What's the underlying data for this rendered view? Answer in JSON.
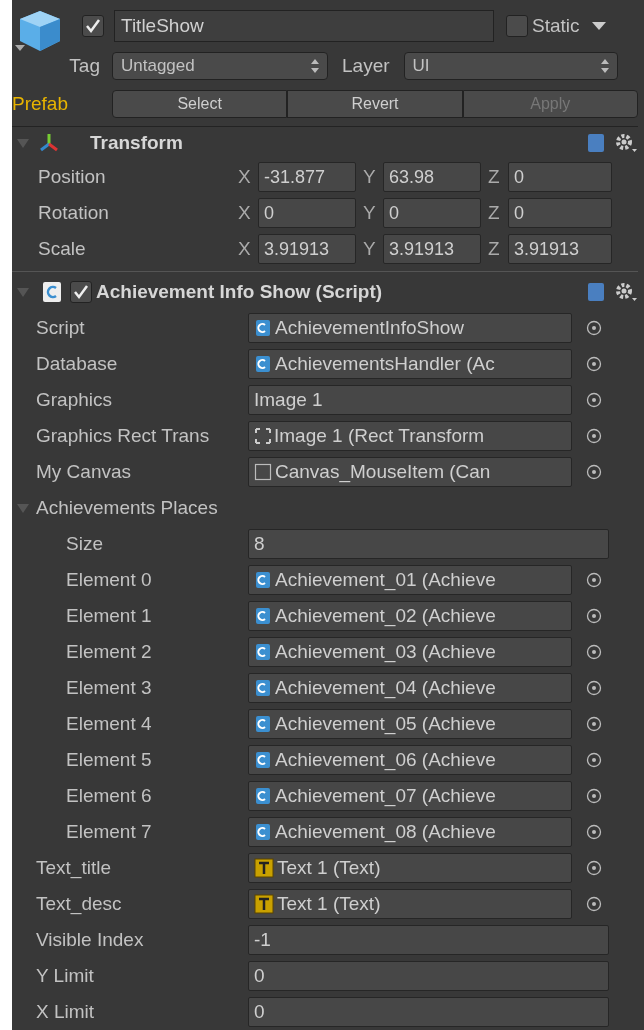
{
  "object": {
    "active": true,
    "name": "TitleShow",
    "static": false,
    "static_label": "Static",
    "tag_label": "Tag",
    "tag": "Untagged",
    "layer_label": "Layer",
    "layer": "UI",
    "prefab_label": "Prefab",
    "prefab_buttons": [
      {
        "label": "Select",
        "disabled": false
      },
      {
        "label": "Revert",
        "disabled": false
      },
      {
        "label": "Apply",
        "disabled": true
      }
    ]
  },
  "transform": {
    "title": "Transform",
    "expanded": true,
    "rows": [
      {
        "label": "Position",
        "fields": [
          {
            "axis": "X",
            "value": "-31.877"
          },
          {
            "axis": "Y",
            "value": "63.98"
          },
          {
            "axis": "Z",
            "value": "0"
          }
        ]
      },
      {
        "label": "Rotation",
        "fields": [
          {
            "axis": "X",
            "value": "0"
          },
          {
            "axis": "Y",
            "value": "0"
          },
          {
            "axis": "Z",
            "value": "0"
          }
        ]
      },
      {
        "label": "Scale",
        "fields": [
          {
            "axis": "X",
            "value": "3.91913"
          },
          {
            "axis": "Y",
            "value": "3.91913"
          },
          {
            "axis": "Z",
            "value": "3.91913"
          }
        ]
      }
    ]
  },
  "script_component": {
    "title": "Achievement Info Show (Script)",
    "enabled": true,
    "expanded": true,
    "properties": [
      {
        "kind": "script_ref",
        "label": "Script",
        "value": "AchievementInfoShow"
      },
      {
        "kind": "script_ref",
        "label": "Database",
        "value": "AchievementsHandler (Ac"
      },
      {
        "kind": "image_ref",
        "label": "Graphics",
        "value": "Image 1"
      },
      {
        "kind": "rect_ref",
        "label": "Graphics Rect Trans",
        "value": "Image 1 (Rect Transform"
      },
      {
        "kind": "canvas_ref",
        "label": "My Canvas",
        "value": "Canvas_MouseItem (Can"
      },
      {
        "kind": "array",
        "label": "Achievements Places",
        "expanded": true,
        "size_label": "Size",
        "size": "8",
        "elements": [
          {
            "kind": "script_ref",
            "label": "Element 0",
            "value": "Achievement_01 (Achieve"
          },
          {
            "kind": "script_ref",
            "label": "Element 1",
            "value": "Achievement_02 (Achieve"
          },
          {
            "kind": "script_ref",
            "label": "Element 2",
            "value": "Achievement_03 (Achieve"
          },
          {
            "kind": "script_ref",
            "label": "Element 3",
            "value": "Achievement_04 (Achieve"
          },
          {
            "kind": "script_ref",
            "label": "Element 4",
            "value": "Achievement_05 (Achieve"
          },
          {
            "kind": "script_ref",
            "label": "Element 5",
            "value": "Achievement_06 (Achieve"
          },
          {
            "kind": "script_ref",
            "label": "Element 6",
            "value": "Achievement_07 (Achieve"
          },
          {
            "kind": "script_ref",
            "label": "Element 7",
            "value": "Achievement_08 (Achieve"
          }
        ]
      },
      {
        "kind": "text_ref",
        "label": "Text_title",
        "value": "Text 1 (Text)"
      },
      {
        "kind": "text_ref",
        "label": "Text_desc",
        "value": "Text 1 (Text)"
      },
      {
        "kind": "number",
        "label": "Visible Index",
        "value": "-1"
      },
      {
        "kind": "number",
        "label": "Y Limit",
        "value": "0"
      },
      {
        "kind": "number",
        "label": "X Limit",
        "value": "0"
      }
    ]
  }
}
